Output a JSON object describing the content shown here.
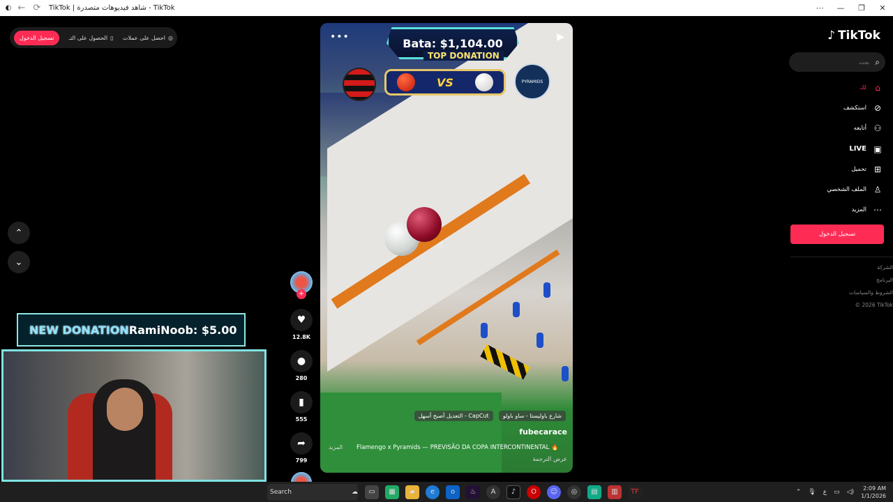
{
  "window": {
    "title": "TikTok | شاهد فيديوهات متصدرة - TikTok",
    "controls": [
      "⋯",
      "—",
      "❐",
      "✕"
    ]
  },
  "top_pill": {
    "signup": "تسجيل الدخول",
    "get_app": "الحصول على التـ",
    "get_coins": "احصل على عملات"
  },
  "video": {
    "overlay_amount": "Bata: $1,104.00",
    "overlay_tag": "TOP DONATION",
    "vs": "VS",
    "crest_right": "PYRAMIDS",
    "chips": [
      "شارع باوليستا - ساو باولو",
      "CapCut - التعديل أصبح أسهل"
    ],
    "author": "fubecarace",
    "description": "Flamengo x Pyramids — PREVISÃO DA COPA INTERCONTINENTAL 🔥",
    "more": "المزيد",
    "translate": "عرض الترجمة"
  },
  "actions": {
    "likes": "12.8K",
    "comments": "280",
    "saves": "555",
    "shares": "799"
  },
  "sidebar": {
    "logo": "TikTok",
    "search_placeholder": "بحث",
    "items": [
      {
        "label": "لك",
        "icon": "home-icon"
      },
      {
        "label": "استكشف",
        "icon": "compass-icon"
      },
      {
        "label": "أتابعه",
        "icon": "following-icon"
      },
      {
        "label": "LIVE",
        "icon": "live-icon"
      },
      {
        "label": "تحميل",
        "icon": "upload-icon"
      },
      {
        "label": "الملف الشخصي",
        "icon": "profile-icon"
      },
      {
        "label": "المزيد",
        "icon": "more-icon"
      }
    ],
    "login_button": "تسجيل الدخول",
    "footer": [
      "الشركة",
      "البرنامج",
      "الشروط والسياسات",
      "© 2026 TikTok"
    ]
  },
  "stream_overlay": {
    "donation_label": "NEW DONATION",
    "donation_value": "RamiNoob: $5.00"
  },
  "taskbar": {
    "search": "Search",
    "lang": "ع",
    "time": "2:09 AM",
    "date": "1/1/2026"
  },
  "colors": {
    "accent": "#fe2c55",
    "overlay_cyan": "#8fe8e2"
  }
}
